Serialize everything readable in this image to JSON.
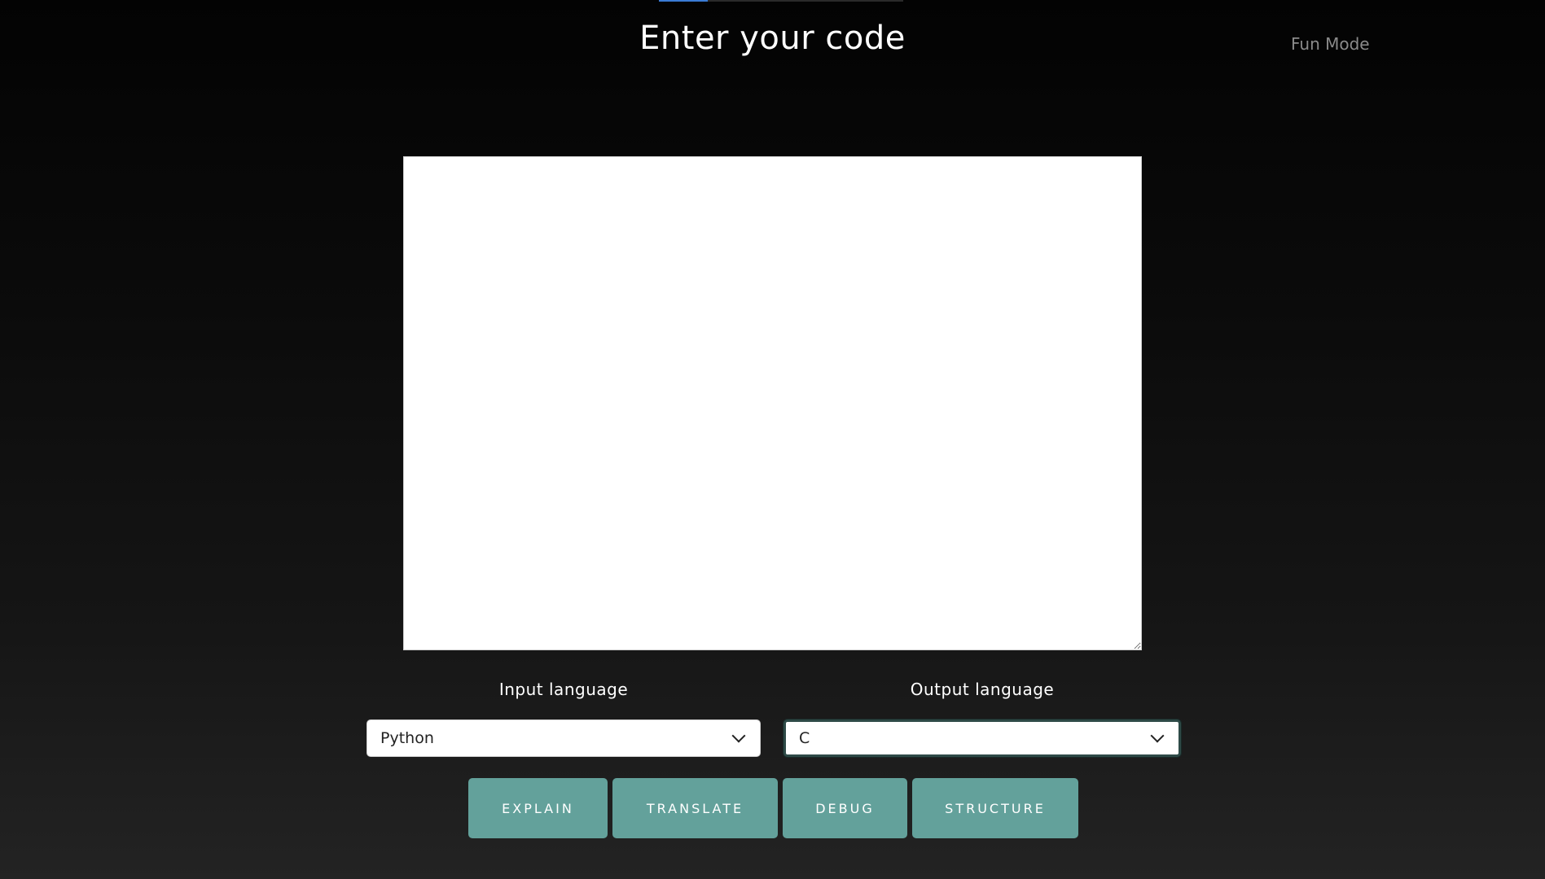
{
  "header": {
    "title": "Enter your code",
    "fun_mode_label": "Fun Mode"
  },
  "editor": {
    "value": "",
    "placeholder": ""
  },
  "languages": {
    "input_label": "Input language",
    "input_selected": "Python",
    "output_label": "Output language",
    "output_selected": "C"
  },
  "actions": {
    "explain_label": "EXPLAIN",
    "translate_label": "TRANSLATE",
    "debug_label": "DEBUG",
    "structure_label": "STRUCTURE"
  },
  "colors": {
    "button_bg": "#63a19b",
    "background_top": "#030303",
    "background_bottom": "#232323",
    "fun_mode_text": "#8a8a8a"
  },
  "icons": {
    "dropdown": "chevron-down-icon"
  }
}
